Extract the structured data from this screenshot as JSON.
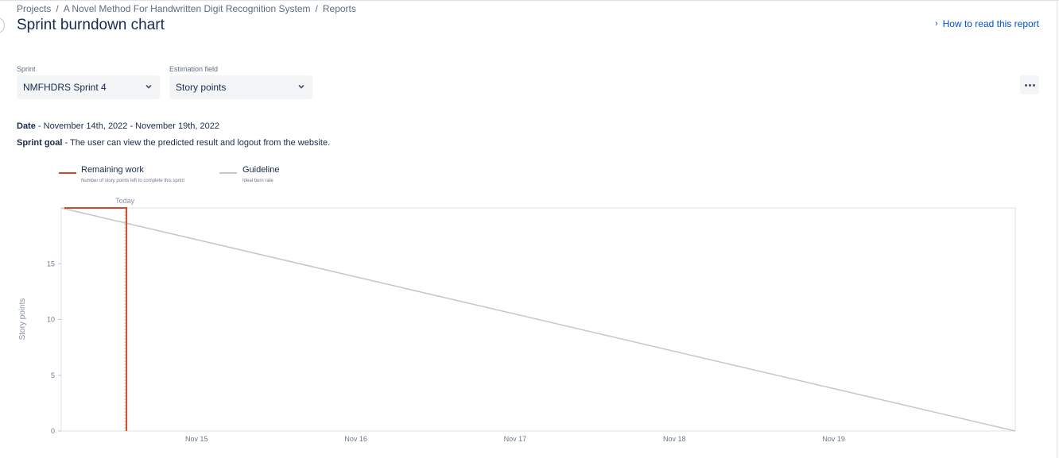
{
  "breadcrumb": {
    "items": [
      "Projects",
      "A Novel Method For Handwritten Digit Recognition System",
      "Reports"
    ],
    "separator": "/"
  },
  "page": {
    "title": "Sprint burndown chart",
    "help_link": "How to read this report"
  },
  "filters": {
    "sprint_label": "Sprint",
    "sprint_value": "NMFHDRS Sprint 4",
    "estimation_label": "Estimation field",
    "estimation_value": "Story points"
  },
  "info": {
    "date_label": "Date",
    "date_value": " - November 14th, 2022 - November 19th, 2022",
    "goal_label": "Sprint goal",
    "goal_value": " - The user can view the predicted result and logout from the website."
  },
  "legend": {
    "remaining_name": "Remaining work",
    "remaining_desc": "Number of story points left to complete this sprint",
    "guideline_name": "Guideline",
    "guideline_desc": "Ideal burn rate"
  },
  "colors": {
    "remaining": "#d04a2a",
    "guideline": "#c1c7d0",
    "link": "#0052cc"
  },
  "chart_data": {
    "type": "line",
    "ylabel": "Story points",
    "today_label": "Today",
    "ylim": [
      0,
      20
    ],
    "yticks": [
      0,
      5,
      10,
      15
    ],
    "xlim": [
      14.0,
      19.99
    ],
    "xticks": [
      {
        "value": 14.85,
        "label": "Nov 15"
      },
      {
        "value": 15.85,
        "label": "Nov 16"
      },
      {
        "value": 16.85,
        "label": "Nov 17"
      },
      {
        "value": 17.85,
        "label": "Nov 18"
      },
      {
        "value": 18.85,
        "label": "Nov 19"
      }
    ],
    "today": 14.4,
    "series": [
      {
        "name": "Remaining work",
        "points": [
          [
            14.02,
            20
          ],
          [
            14.41,
            20
          ],
          [
            14.41,
            0
          ]
        ]
      },
      {
        "name": "Guideline",
        "points": [
          [
            14.0,
            20
          ],
          [
            19.99,
            0
          ]
        ]
      }
    ]
  }
}
